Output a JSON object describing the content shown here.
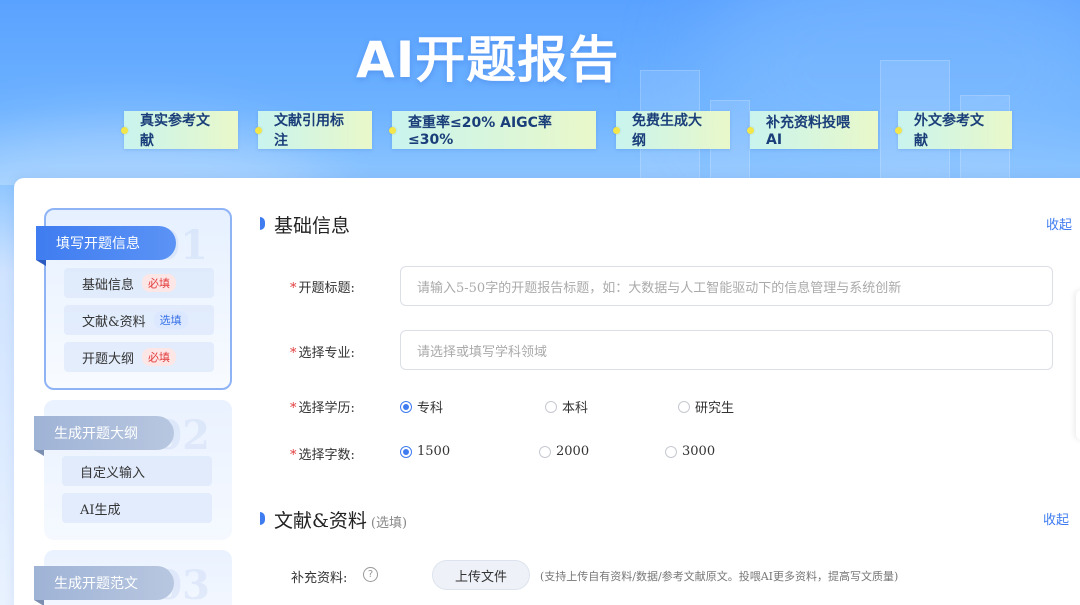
{
  "hero": {
    "title": "AI开题报告",
    "tags": [
      "真实参考文献",
      "文献引用标注",
      "查重率≤20%  AIGC率≤30%",
      "免费生成大纲",
      "补充资料投喂AI",
      "外文参考文献"
    ]
  },
  "steps": [
    {
      "num": "01",
      "title": "填写开题信息",
      "items": [
        {
          "label": "基础信息",
          "badge": "必填",
          "badge_type": "required"
        },
        {
          "label": "文献&资料",
          "badge": "选填",
          "badge_type": "optional"
        },
        {
          "label": "开题大纲",
          "badge": "必填",
          "badge_type": "required"
        }
      ]
    },
    {
      "num": "02",
      "title": "生成开题大纲",
      "items": [
        {
          "label": "自定义输入"
        },
        {
          "label": "AI生成"
        }
      ]
    },
    {
      "num": "03",
      "title": "生成开题范文"
    }
  ],
  "basic": {
    "title": "基础信息",
    "collapse": "收起",
    "topic_label": "开题标题:",
    "topic_placeholder": "请输入5-50字的开题报告标题，如：大数据与人工智能驱动下的信息管理与系统创新",
    "major_label": "选择专业:",
    "major_placeholder": "请选择或填写学科领域",
    "degree_label": "选择学历:",
    "degree_options": [
      "专科",
      "本科",
      "研究生"
    ],
    "degree_selected": "专科",
    "words_label": "选择字数:",
    "words_options": [
      "1500",
      "2000",
      "3000"
    ],
    "words_selected": "1500",
    "required_mark": "*"
  },
  "literature": {
    "title": "文献&资料",
    "optional": "(选填)",
    "collapse": "收起",
    "supplement_label": "补充资料:",
    "help": "?",
    "upload_label": "上传文件",
    "upload_hint": "(支持上传自有资料/数据/参考文献原文。投喂AI更多资料，提高写文质量)"
  },
  "colors": {
    "accent": "#3f7cf0",
    "required": "#e23b3b",
    "hero_bg": "#5aa2ff"
  }
}
